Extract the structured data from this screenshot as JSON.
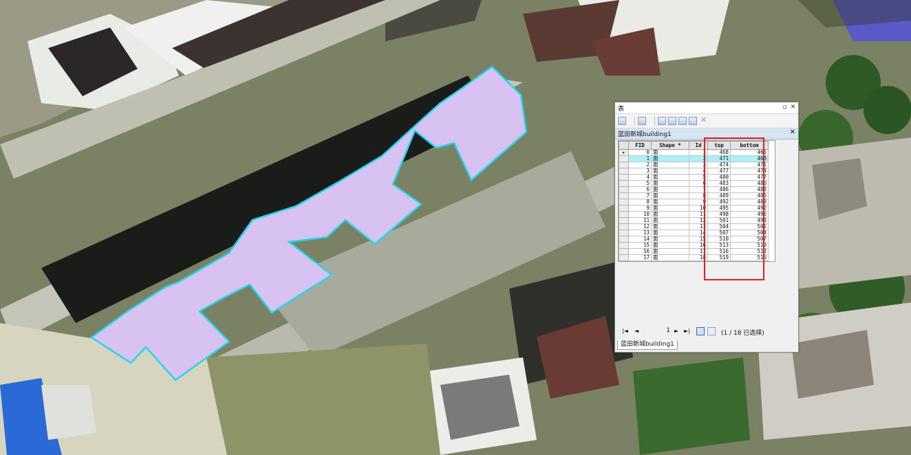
{
  "window": {
    "title": "表",
    "layer_tab": "蓝田新城building1",
    "bottom_tab": "蓝田新城building1"
  },
  "table": {
    "columns": [
      "FID",
      "Shape *",
      "Id",
      "top",
      "bottom"
    ],
    "rows": [
      {
        "fid": "0",
        "shape": "面",
        "id": "1",
        "top": "468",
        "bottom": "465"
      },
      {
        "fid": "1",
        "shape": "面",
        "id": "2",
        "top": "471",
        "bottom": "468"
      },
      {
        "fid": "2",
        "shape": "面",
        "id": "3",
        "top": "474",
        "bottom": "471"
      },
      {
        "fid": "3",
        "shape": "面",
        "id": "4",
        "top": "477",
        "bottom": "474"
      },
      {
        "fid": "4",
        "shape": "面",
        "id": "5",
        "top": "480",
        "bottom": "477"
      },
      {
        "fid": "5",
        "shape": "面",
        "id": "6",
        "top": "483",
        "bottom": "480"
      },
      {
        "fid": "6",
        "shape": "面",
        "id": "7",
        "top": "486",
        "bottom": "483"
      },
      {
        "fid": "7",
        "shape": "面",
        "id": "8",
        "top": "489",
        "bottom": "486"
      },
      {
        "fid": "8",
        "shape": "面",
        "id": "9",
        "top": "492",
        "bottom": "489"
      },
      {
        "fid": "9",
        "shape": "面",
        "id": "10",
        "top": "495",
        "bottom": "492"
      },
      {
        "fid": "10",
        "shape": "面",
        "id": "11",
        "top": "498",
        "bottom": "495"
      },
      {
        "fid": "11",
        "shape": "面",
        "id": "12",
        "top": "501",
        "bottom": "498"
      },
      {
        "fid": "12",
        "shape": "面",
        "id": "13",
        "top": "504",
        "bottom": "501"
      },
      {
        "fid": "13",
        "shape": "面",
        "id": "14",
        "top": "507",
        "bottom": "504"
      },
      {
        "fid": "14",
        "shape": "面",
        "id": "15",
        "top": "510",
        "bottom": "507"
      },
      {
        "fid": "15",
        "shape": "面",
        "id": "16",
        "top": "513",
        "bottom": "510"
      },
      {
        "fid": "16",
        "shape": "面",
        "id": "17",
        "top": "516",
        "bottom": "513"
      },
      {
        "fid": "17",
        "shape": "面",
        "id": "18",
        "top": "519",
        "bottom": "516"
      }
    ]
  },
  "nav": {
    "record": "1",
    "status": "(1 / 18 已选择)"
  },
  "colors": {
    "polygon_fill": "#d8c2f2",
    "polygon_stroke": "#1fd8ee",
    "highlight_row": "#a8f2f8",
    "red_box": "#e0201a"
  }
}
